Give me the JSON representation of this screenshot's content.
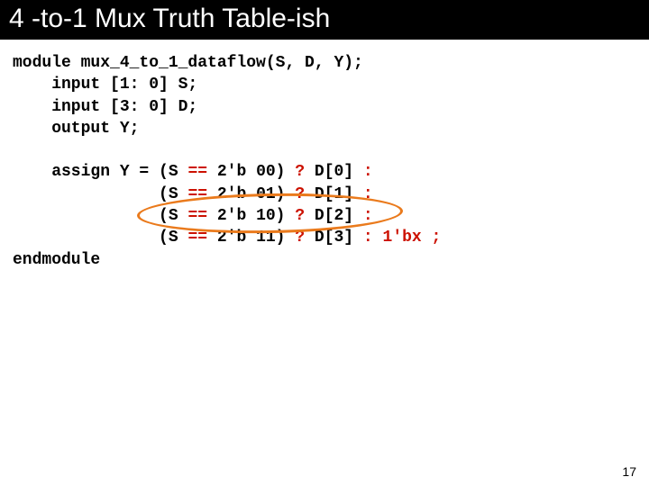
{
  "title": "4 -to-1 Mux Truth Table-ish",
  "code": {
    "line1": "module mux_4_to_1_dataflow(S, D, Y);",
    "line2": "    input [1: 0] S;",
    "line3": "    input [3: 0] D;",
    "line4": "    output Y;",
    "line5": "",
    "assign_head": "    assign Y = ",
    "eq": " == ",
    "lp": "(S",
    "r0b": "2'b 00) ",
    "r1b": "2'b 01) ",
    "r2b": "2'b 10) ",
    "r3b": "2'b 11) ",
    "q": "?",
    "d0": " D[0] ",
    "d1": " D[1] ",
    "d2": " D[2] ",
    "d3": " D[3] ",
    "colon": ":",
    "pad": "               ",
    "tail": " 1'bx ;",
    "endmod": "endmodule"
  },
  "pageNumber": "17"
}
